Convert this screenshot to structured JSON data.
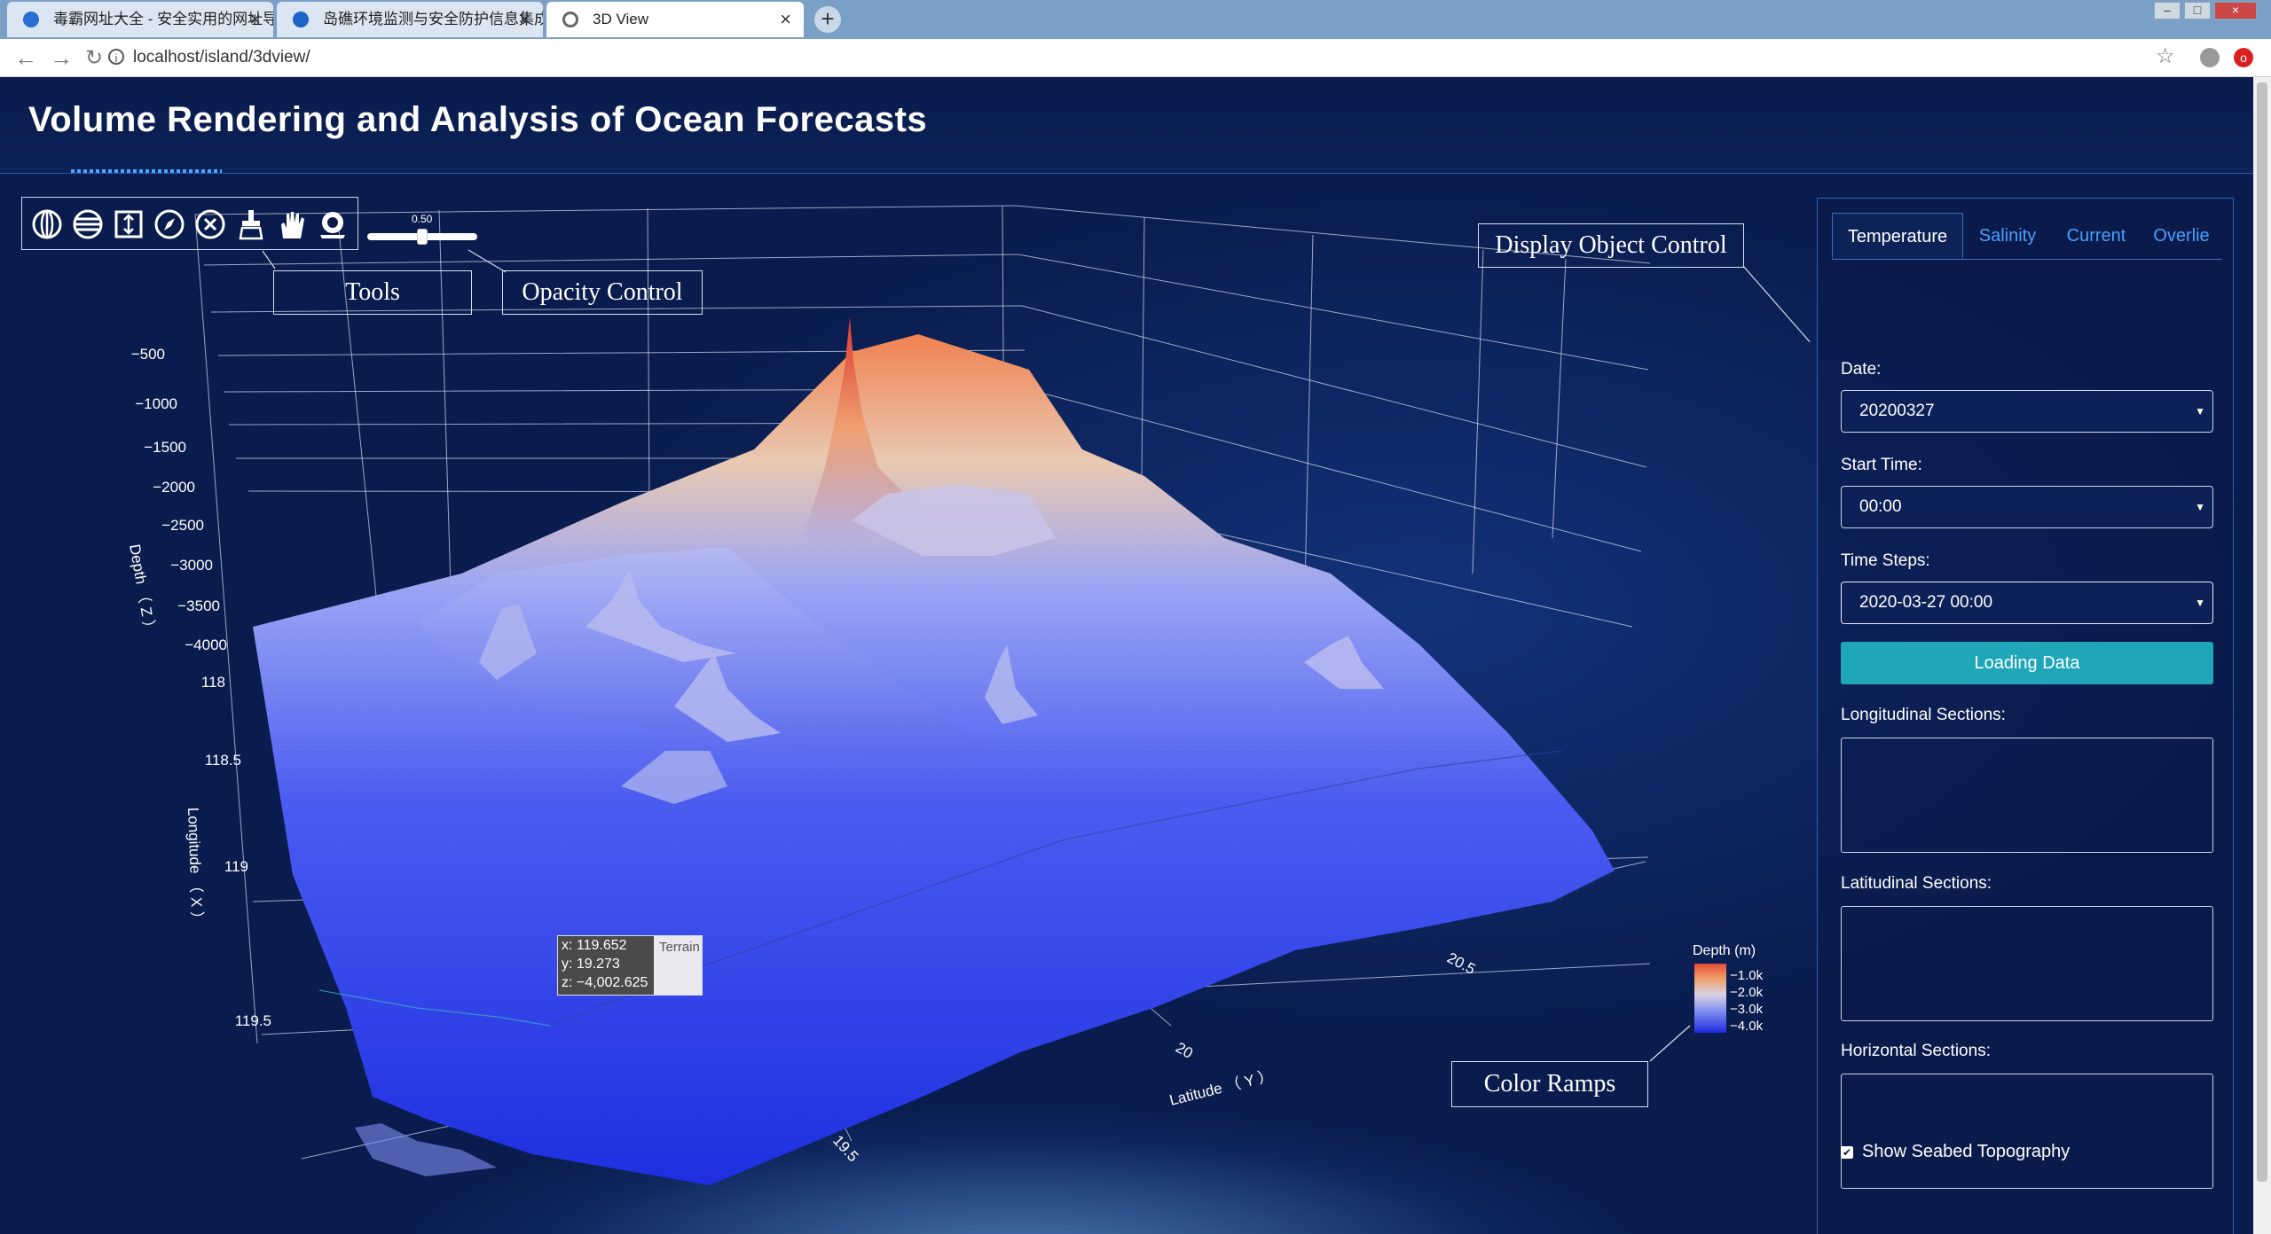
{
  "browser": {
    "tabs": [
      {
        "title": "毒霸网址大全 - 安全实用的网址导航"
      },
      {
        "title": "岛礁环境监测与安全防护信息集成"
      },
      {
        "title": "3D View"
      }
    ],
    "url": "localhost/island/3dview/"
  },
  "app": {
    "title": "Volume Rendering and Analysis of Ocean Forecasts",
    "tool_icons": [
      "globe-icon",
      "layers-icon",
      "vertical-resize-icon",
      "compass-icon",
      "close-circle-icon",
      "brush-icon",
      "hand-icon",
      "reset-icon"
    ],
    "opacity_value": "0.50",
    "opacity": 0.5,
    "callouts": {
      "tools": "Tools",
      "opacity": "Opacity Control",
      "display": "Display Object Control",
      "colors": "Color Ramps"
    }
  },
  "plot": {
    "axes": {
      "z_title": "Depth （ Z ）",
      "x_title": "Longitude （ X ）",
      "y_title": "Latitude （ Y ）",
      "z_ticks": [
        "−500",
        "−1000",
        "−1500",
        "−2000",
        "−2500",
        "−3000",
        "−3500",
        "−4000"
      ],
      "x_ticks": [
        "118",
        "118.5",
        "119",
        "119.5"
      ],
      "y_ticks": [
        "19.5",
        "20",
        "20.5"
      ]
    },
    "tooltip": {
      "x": "x: 119.652",
      "y": "y: 19.273",
      "z": "z: −4,002.625",
      "trace": "Terrain"
    },
    "colorbar": {
      "title": "Depth (m)",
      "ticks": [
        "−1.0k",
        "−2.0k",
        "−3.0k",
        "−4.0k"
      ]
    }
  },
  "panel": {
    "tabs": [
      "Temperature",
      "Salinity",
      "Current",
      "Overlie"
    ],
    "date_label": "Date:",
    "date_value": "20200327",
    "start_label": "Start Time:",
    "start_value": "00:00",
    "steps_label": "Time Steps:",
    "steps_value": "2020-03-27 00:00",
    "load_button": "Loading Data",
    "long_label": "Longitudinal Sections:",
    "lat_label": "Latitudinal Sections:",
    "hor_label": "Horizontal Sections:",
    "seabed_label": "Show Seabed Topography",
    "seabed_checked": true
  }
}
